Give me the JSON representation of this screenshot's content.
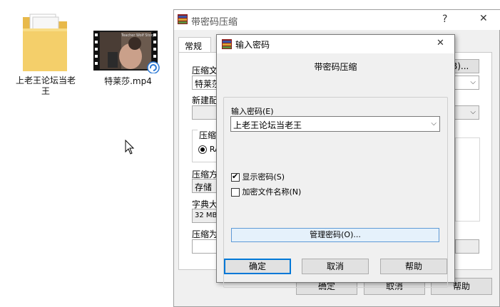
{
  "desktop": {
    "folder_label_line1": "上老王论坛当老",
    "folder_label_line2": "王",
    "video_label": "特莱莎.mp4",
    "video_overlay_text": "Teacher Wolf Story"
  },
  "back_dialog": {
    "title": "带密码压缩",
    "help_button": "?",
    "close_button": "✕",
    "tab_general": "常规",
    "archive_name_label": "压缩文",
    "archive_name_value": "特莱莎",
    "browse_button_partial": "B)...",
    "new_profile_label": "新建配",
    "compress_format_label": "压缩",
    "radio_rar": "RA",
    "method_label": "压缩方",
    "method_value": "存储",
    "dict_label": "字典大",
    "dict_value": "32 MB",
    "split_label": "压缩为",
    "ok_button": "确定",
    "cancel_button": "取消",
    "help_btn": "帮助"
  },
  "front_dialog": {
    "title": "输入密码",
    "close_button": "✕",
    "header": "带密码压缩",
    "password_label": "输入密码(E)",
    "password_value": "上老王论坛当老王",
    "show_password_label": "显示密码(S)",
    "show_password_checked": true,
    "encrypt_names_label": "加密文件名称(N)",
    "encrypt_names_checked": false,
    "manage_button": "管理密码(O)...",
    "ok_button": "确定",
    "cancel_button": "取消",
    "help_button": "帮助"
  },
  "colors": {
    "accent": "#0078d7",
    "dialog_bg": "#f0f0f0",
    "manage_btn_bg": "#e5f1fb"
  }
}
